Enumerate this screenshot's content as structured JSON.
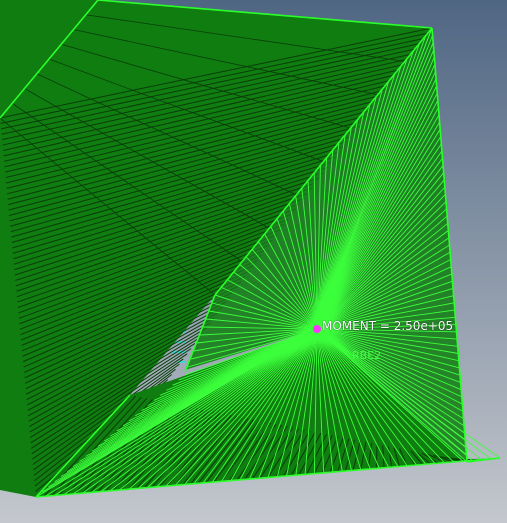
{
  "scene": {
    "background_top": "#4f6683",
    "background_bottom": "#c4c7cd",
    "mesh_fill": "#0f7d0f",
    "mesh_line": "#0a3d0a",
    "spider_line": "#3cff3c",
    "edge_line": "#2aff2a",
    "hidden_mesh_color": "#19e6e6",
    "node_color": "#ff33ff"
  },
  "annotations": {
    "moment_label": "MOMENT = 2.50e+05",
    "rbe_label": "RBE2"
  }
}
